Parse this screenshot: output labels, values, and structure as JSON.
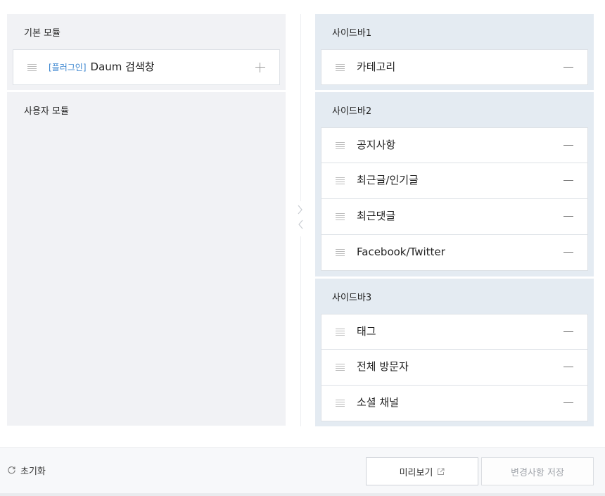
{
  "left": {
    "basic_title": "기본 모듈",
    "basic_items": [
      {
        "tag": "[플러그인]",
        "label": "Daum 검색창"
      }
    ],
    "user_title": "사용자 모듈"
  },
  "right": {
    "sidebar1": {
      "title": "사이드바1",
      "items": [
        "카테고리"
      ]
    },
    "sidebar2": {
      "title": "사이드바2",
      "items": [
        "공지사항",
        "최근글/인기글",
        "최근댓글",
        "Facebook/Twitter"
      ]
    },
    "sidebar3": {
      "title": "사이드바3",
      "items": [
        "태그",
        "전체 방문자",
        "소셜 채널"
      ]
    }
  },
  "footer": {
    "reset_label": "초기화",
    "preview_label": "미리보기",
    "save_label": "변경사항 저장"
  },
  "icons": {
    "drag": "drag-handle-icon",
    "add": "plus-icon",
    "remove": "minus-icon",
    "reset": "refresh-icon",
    "external": "external-link-icon",
    "move_right": "chevron-right-icon",
    "move_left": "chevron-left-icon"
  },
  "colors": {
    "plugin_tag": "#3b86d0",
    "left_bg": "#f1f2f5",
    "right_bg": "#e4ebf2"
  }
}
